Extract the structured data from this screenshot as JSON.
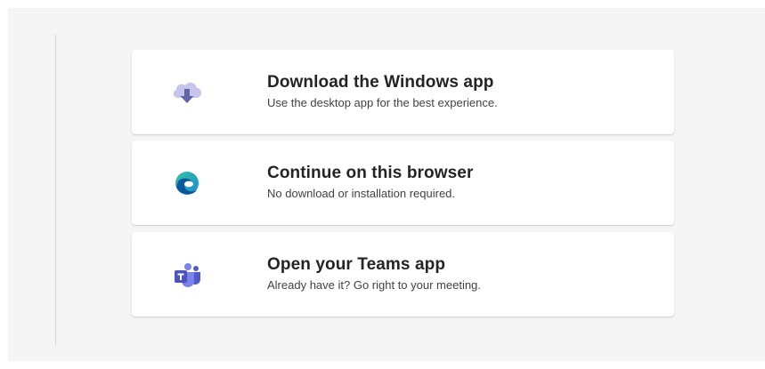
{
  "options": [
    {
      "title": "Download the Windows app",
      "subtitle": "Use the desktop app for the best experience.",
      "icon": "cloud-download-icon"
    },
    {
      "title": "Continue on this browser",
      "subtitle": "No download or installation required.",
      "icon": "edge-browser-icon"
    },
    {
      "title": "Open your Teams app",
      "subtitle": "Already have it? Go right to your meeting.",
      "icon": "teams-icon"
    }
  ],
  "colors": {
    "background": "#f5f5f5",
    "card": "#ffffff",
    "title": "#242424",
    "subtitle": "#424242",
    "cloud": "#c7c4ee",
    "arrow": "#6264a7",
    "teams": "#5b5fc7"
  }
}
